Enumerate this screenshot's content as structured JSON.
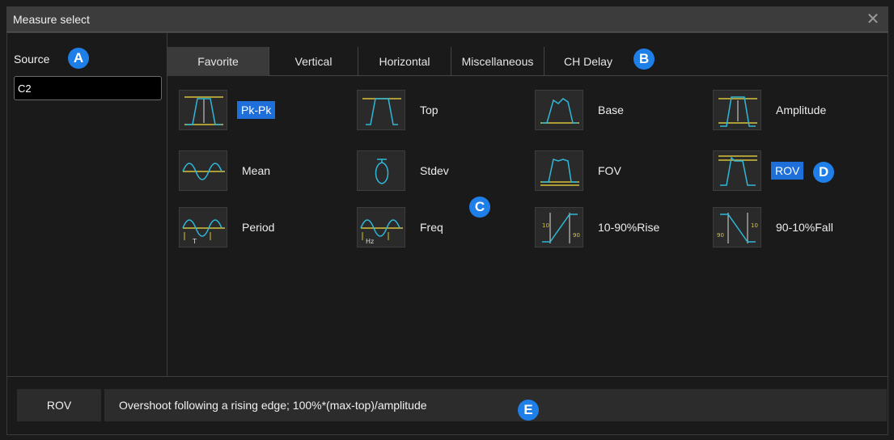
{
  "window": {
    "title": "Measure select",
    "close_glyph": "✕"
  },
  "source": {
    "label": "Source",
    "value": "C2"
  },
  "tabs": [
    {
      "label": "Favorite",
      "active": true
    },
    {
      "label": "Vertical",
      "active": false
    },
    {
      "label": "Horizontal",
      "active": false
    },
    {
      "label": "Miscellaneous",
      "active": false
    },
    {
      "label": "CH Delay",
      "active": false
    }
  ],
  "measurements": [
    {
      "label": "Pk-Pk",
      "icon": "pk-pk-icon",
      "selected": true
    },
    {
      "label": "Top",
      "icon": "top-icon",
      "selected": false
    },
    {
      "label": "Base",
      "icon": "base-icon",
      "selected": false
    },
    {
      "label": "Amplitude",
      "icon": "amplitude-icon",
      "selected": false
    },
    {
      "label": "Mean",
      "icon": "mean-icon",
      "selected": false
    },
    {
      "label": "Stdev",
      "icon": "stdev-icon",
      "selected": false
    },
    {
      "label": "FOV",
      "icon": "fov-icon",
      "selected": false
    },
    {
      "label": "ROV",
      "icon": "rov-icon",
      "selected": true
    },
    {
      "label": "Period",
      "icon": "period-icon",
      "selected": false
    },
    {
      "label": "Freq",
      "icon": "freq-icon",
      "selected": false
    },
    {
      "label": "10-90%Rise",
      "icon": "rise-icon",
      "selected": false
    },
    {
      "label": "90-10%Fall",
      "icon": "fall-icon",
      "selected": false
    }
  ],
  "markers": {
    "a": "A",
    "b": "B",
    "c": "C",
    "d": "D",
    "e": "E"
  },
  "info": {
    "name": "ROV",
    "description": "Overshoot following a rising edge; 100%*(max-top)/amplitude"
  },
  "colors": {
    "accent": "#1e6fd9",
    "marker": "#1f7fe8",
    "waveform": "#2fb8d8",
    "level_line": "#d7c23a"
  }
}
